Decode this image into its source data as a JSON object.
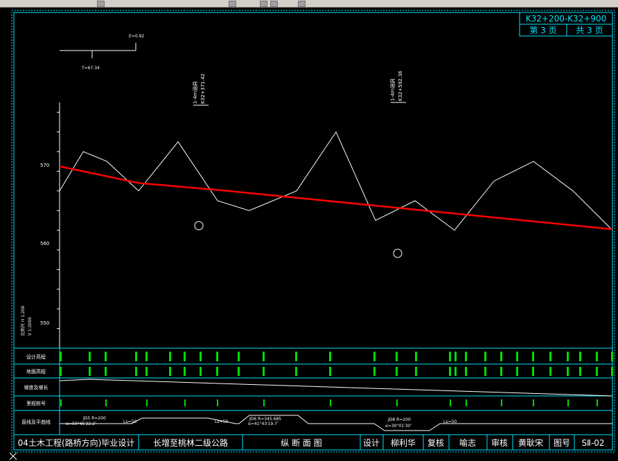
{
  "title_block": {
    "range": "K32+200-K32+900",
    "page": "第 3 页",
    "total": "共 3 页"
  },
  "footer": {
    "course": "04土木工程(路桥方向)毕业设计",
    "project": "长增至桃林二级公路",
    "drawing": "纵 断 面 图",
    "design_label": "设计",
    "designer": "柳利华",
    "review_label": "复核",
    "reviewer": "喻志",
    "audit_label": "审核",
    "auditor": "黄耿宋",
    "figno_label": "图号",
    "figno": "SⅡ-02"
  },
  "table_rows": {
    "design_elev": "设计高程",
    "ground_elev": "地面高程",
    "slope": "坡度及坡长",
    "stake": "里程桩号",
    "alignment": "直线及平曲线"
  },
  "vcurve": {
    "e": "E=0.92",
    "t": "T=67.34"
  },
  "structures": [
    {
      "name": "1-4m涵洞",
      "stake": "K32+371.42"
    },
    {
      "name": "1-4m涵洞",
      "stake": "K32+592.36"
    }
  ],
  "elev_ticks": [
    "570",
    "560",
    "550"
  ],
  "scale_note": [
    "比例尺 H 1:200",
    "V 1:2000"
  ],
  "curves": [
    {
      "label": "JD5 R=200",
      "sub": "α=50°45′22.2″",
      "ls": "Ls=50"
    },
    {
      "label": "JD6 R=345.685",
      "sub": "α=41°43′19.7″",
      "ls": "Ls=50"
    },
    {
      "label": "JD8 R=200",
      "sub": "α=30°01′30″",
      "ls": "Ls=50"
    }
  ],
  "colors": {
    "frame": "#00e5ff",
    "design_line": "#ff0000",
    "ground_line": "#ffffff",
    "data_text": "#00dd00"
  },
  "chart_data": {
    "type": "line",
    "xlabel": "",
    "ylabel": "",
    "ylim": [
      550,
      575
    ],
    "series": [
      {
        "name": "",
        "x": [
          0,
          30,
          60,
          100,
          150,
          200,
          240,
          300,
          350,
          400,
          450,
          500,
          550,
          600,
          650,
          700
        ],
        "values": [
          566,
          570,
          569,
          566,
          571,
          565,
          564,
          566,
          572,
          563,
          565,
          562,
          567,
          569,
          566,
          562
        ]
      },
      {
        "name": "",
        "x": [
          0,
          100,
          200,
          300,
          400,
          500,
          600,
          700
        ],
        "values": [
          568.5,
          566.8,
          566.1,
          565.3,
          564.5,
          563.7,
          562.9,
          562.1
        ]
      }
    ]
  }
}
